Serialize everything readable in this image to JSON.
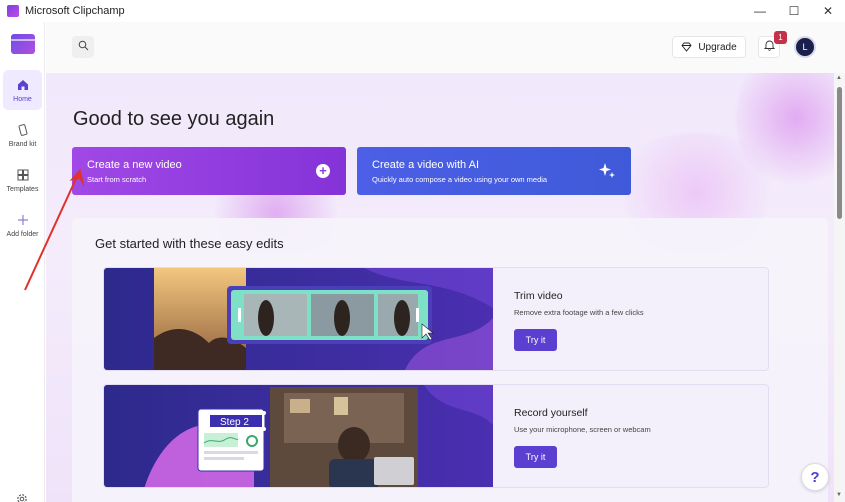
{
  "window": {
    "title": "Microsoft Clipchamp",
    "minimize": "—",
    "maximize": "☐",
    "close": "✕"
  },
  "sidebar": {
    "items": [
      {
        "label": "Home",
        "icon": "home-icon",
        "active": true
      },
      {
        "label": "Brand kit",
        "icon": "brand-kit-icon",
        "active": false
      },
      {
        "label": "Templates",
        "icon": "templates-icon",
        "active": false
      },
      {
        "label": "Add folder",
        "icon": "add-folder-icon",
        "active": false
      }
    ],
    "settings_icon": "gear-icon"
  },
  "topbar": {
    "upgrade_label": "Upgrade",
    "notification_count": "1",
    "avatar_initial": "L"
  },
  "main": {
    "greeting": "Good to see you again",
    "cta_new": {
      "title": "Create a new video",
      "subtitle": "Start from scratch"
    },
    "cta_ai": {
      "title": "Create a video with AI",
      "subtitle": "Quickly auto compose a video using your own media"
    },
    "edits_title": "Get started with these easy edits",
    "cards": [
      {
        "title": "Trim video",
        "description": "Remove extra footage with a few clicks",
        "button": "Try it"
      },
      {
        "title": "Record yourself",
        "description": "Use your microphone, screen or webcam",
        "button": "Try it",
        "thumb_label": "Step 2"
      }
    ]
  },
  "help_label": "?",
  "colors": {
    "accent": "#5b3fd1",
    "cta_new": "#9b40e3",
    "cta_ai": "#4560e2",
    "badge": "#c4314b",
    "annotation_arrow": "#e0312a"
  }
}
